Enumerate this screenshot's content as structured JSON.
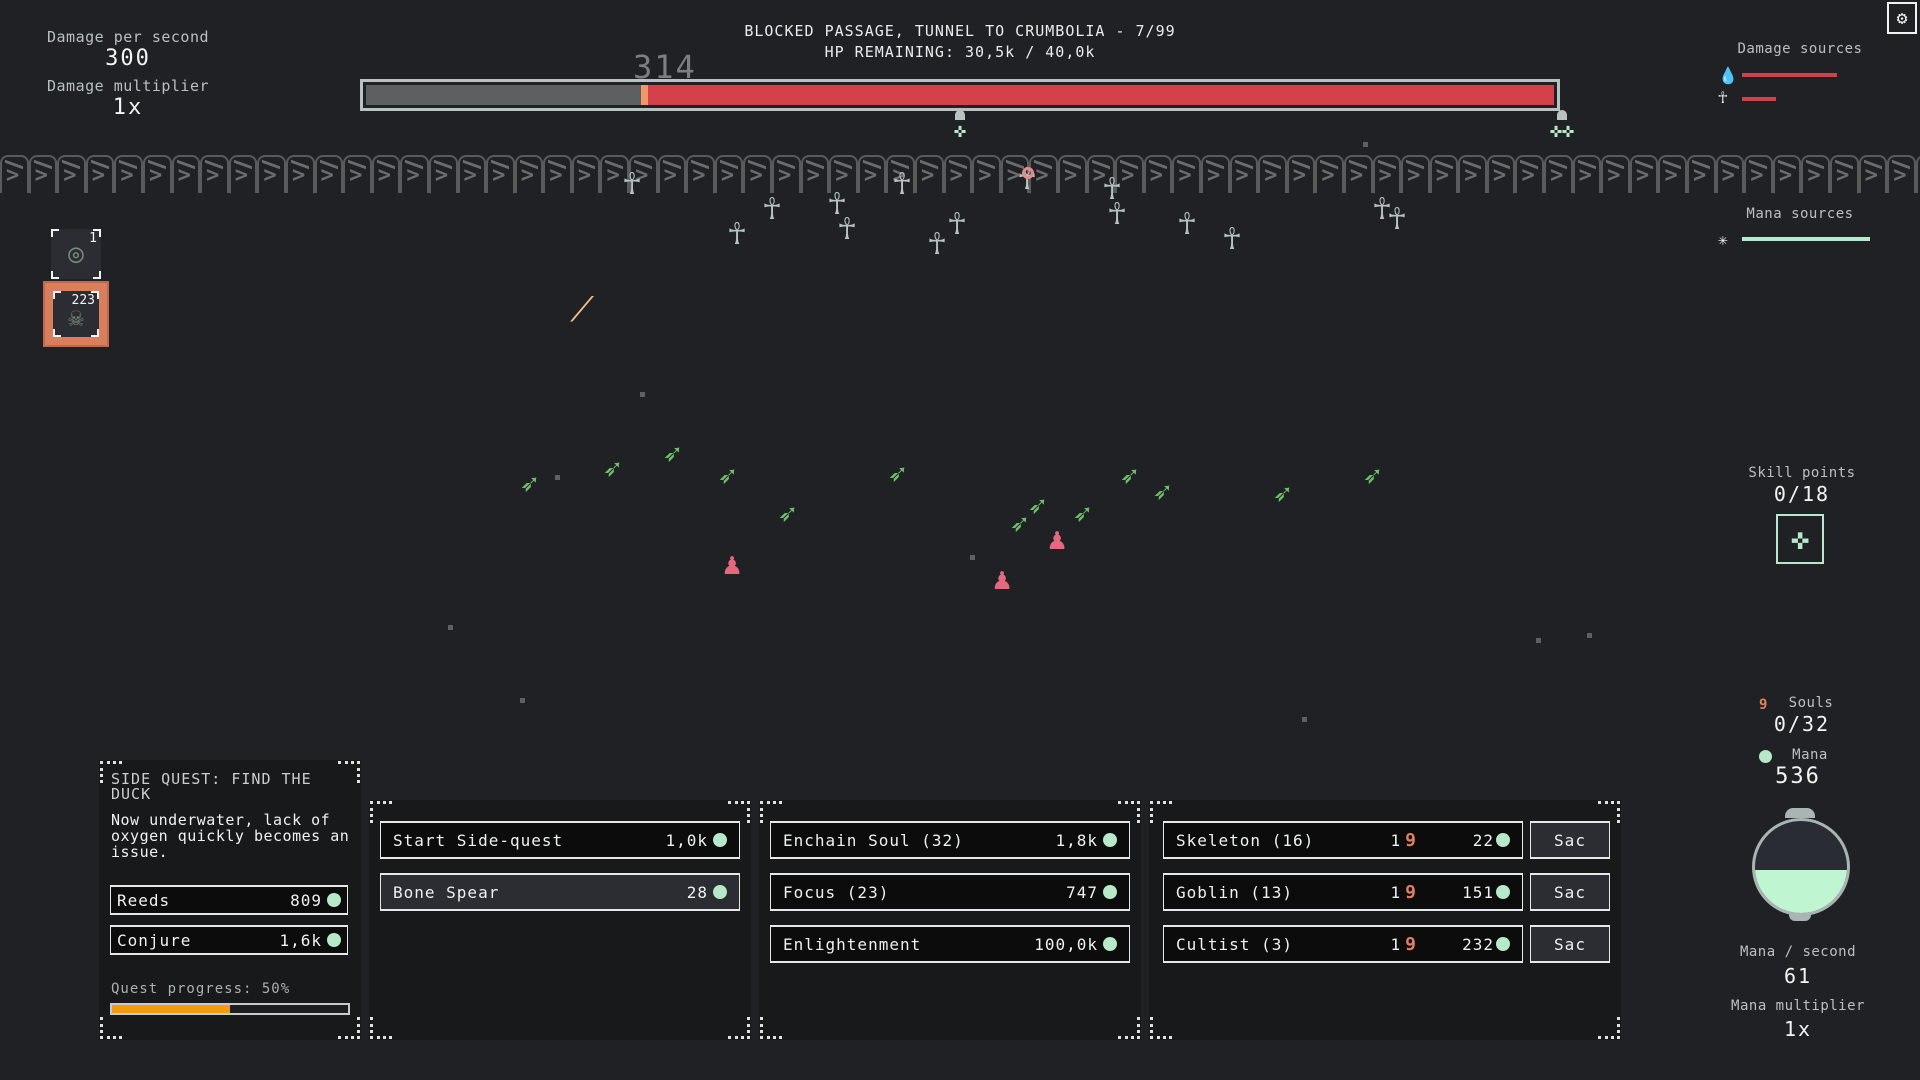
{
  "left_stats": {
    "dps_label": "Damage per second",
    "dps_value": "300",
    "dmg_mult_label": "Damage multiplier",
    "dmg_mult_value": "1x"
  },
  "header": {
    "level_title": "BLOCKED PASSAGE, TUNNEL TO CRUMBOLIA - 7/99",
    "hp_text": "HP REMAINING: 30,5k / 40,0k",
    "hp_remaining": 30500,
    "hp_max": 40000,
    "floating_damage": "314",
    "colors": {
      "hp_fill": "#d4414a",
      "hp_empty": "#5e5f60",
      "hp_edge": "#f3966a"
    }
  },
  "abilities": [
    {
      "icon": "target-icon",
      "glyph": "◎",
      "count": "1",
      "active": false
    },
    {
      "icon": "poison-skull-icon",
      "glyph": "☠",
      "count": "223",
      "active": true
    }
  ],
  "side_quest": {
    "title": "SIDE QUEST: FIND THE DUCK",
    "description": "Now underwater, lack of oxygen quickly becomes an issue.",
    "actions": [
      {
        "label": "Reeds",
        "cost": "809"
      },
      {
        "label": "Conjure",
        "cost": "1,6k"
      }
    ],
    "progress_label": "Quest progress: 50%",
    "progress": 0.5
  },
  "panel_quests": {
    "buttons": [
      {
        "label": "Start Side-quest",
        "cost": "1,0k",
        "highlighted": false
      },
      {
        "label": "Bone Spear",
        "cost": "28",
        "highlighted": true
      }
    ]
  },
  "panel_spells": {
    "buttons": [
      {
        "label": "Enchain Soul (32)",
        "cost": "1,8k"
      },
      {
        "label": "Focus (23)",
        "cost": "747"
      },
      {
        "label": "Enlightenment",
        "cost": "100,0k"
      }
    ]
  },
  "panel_units": {
    "rows": [
      {
        "label": "Skeleton (16)",
        "souls": "1",
        "mana": "22",
        "sac_label": "Sac"
      },
      {
        "label": "Goblin (13)",
        "souls": "1",
        "mana": "151",
        "sac_label": "Sac"
      },
      {
        "label": "Cultist (3)",
        "souls": "1",
        "mana": "232",
        "sac_label": "Sac"
      }
    ]
  },
  "right_panel": {
    "damage_sources_label": "Damage sources",
    "damage_sources": [
      {
        "icon": "poison-drop-icon",
        "glyph": "💧",
        "share": 1.0
      },
      {
        "icon": "skeleton-icon",
        "glyph": "☥",
        "share": 0.36
      }
    ],
    "mana_sources_label": "Mana sources",
    "mana_sources": [
      {
        "icon": "spark-icon",
        "glyph": "✳",
        "share": 1.0
      }
    ],
    "skill_points_label": "Skill points",
    "skill_points_value": "0/18",
    "souls_label": "Souls",
    "souls_value": "0/32",
    "mana_label": "Mana",
    "mana_value": "536",
    "mana_fill": 0.47,
    "mana_per_sec_label": "Mana / second",
    "mana_per_sec_value": "61",
    "mana_mult_label": "Mana multiplier",
    "mana_mult_value": "1x",
    "colors": {
      "damage": "#c9454b",
      "mana": "#b6e8c9",
      "soul": "#e27e61"
    }
  },
  "battlefield": {
    "skeleton_glyph": "☥",
    "archer_glyph": "🏹",
    "cultist_glyph": "♟"
  }
}
